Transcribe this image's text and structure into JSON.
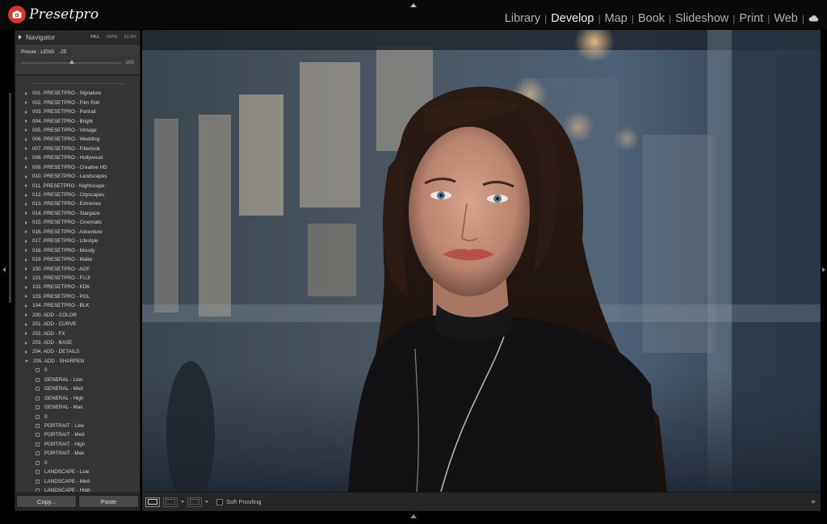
{
  "app": {
    "logo_text": "Presetpro",
    "modules": [
      "Library",
      "Develop",
      "Map",
      "Book",
      "Slideshow",
      "Print",
      "Web"
    ],
    "active_module": "Develop"
  },
  "navigator": {
    "title": "Navigator",
    "zoom_options": [
      "FILL",
      "100%",
      "33.3%"
    ],
    "preset_label": "Preset : LENS",
    "preset_amount": "-25",
    "slider_value": "100",
    "slider_fraction": 0.5
  },
  "presets": {
    "folders": [
      "001. PRESETPRO - Signature",
      "002. PRESETPRO - Film Roll",
      "003. PRESETPRO - Portrait",
      "004. PRESETPRO - Bright",
      "005. PRESETPRO - Vintage",
      "006. PRESETPRO - Wedding",
      "007. PRESETPRO - Filterlook",
      "008. PRESETPRO - Hollywood",
      "009. PRESETPRO - Creative HD",
      "010. PRESETPRO - Landscapes",
      "011. PRESETPRO - Nightscape",
      "012. PRESETPRO - Cityscapes",
      "013. PRESETPRO - Extremes",
      "014. PRESETPRO - Stargaze",
      "015. PRESETPRO - Cinematic",
      "016. PRESETPRO - Adventure",
      "017. PRESETPRO - Lifestyle",
      "018. PRESETPRO - Moody",
      "019. PRESETPRO - Matte",
      "100. PRESETPRO - AGF",
      "101. PRESETPRO - FUJI",
      "102. PRESETPRO - KDK",
      "103. PRESETPRO - POL",
      "104. PRESETPRO - BLK",
      "200. ADD - COLOR",
      "201. ADD - CURVE",
      "202. ADD - FX",
      "203. ADD - BASE",
      "204. ADD - DETAILS"
    ],
    "open_folder": "205. ADD - SHARPEN",
    "open_folder_items": [
      "0",
      "GENERAL - Low",
      "GENERAL - Med",
      "GENERAL - High",
      "GENERAL - Max",
      "0",
      "PORTRAIT - Low",
      "PORTRAIT - Med",
      "PORTRAIT - High",
      "PORTRAIT - Max",
      "0",
      "LANDSCAPE - Low",
      "LANDSCAPE - Med",
      "LANDSCAPE - High"
    ]
  },
  "buttons": {
    "copy": "Copy...",
    "paste": "Paste"
  },
  "toolbar": {
    "soft_proofing": "Soft Proofing"
  },
  "colors": {
    "logo_red": "#d9362b",
    "panel_bg": "#353535",
    "chrome_bg": "#0a0a0a"
  },
  "icons": {
    "logo": "camera-icon",
    "cloud": "cloud-icon"
  }
}
